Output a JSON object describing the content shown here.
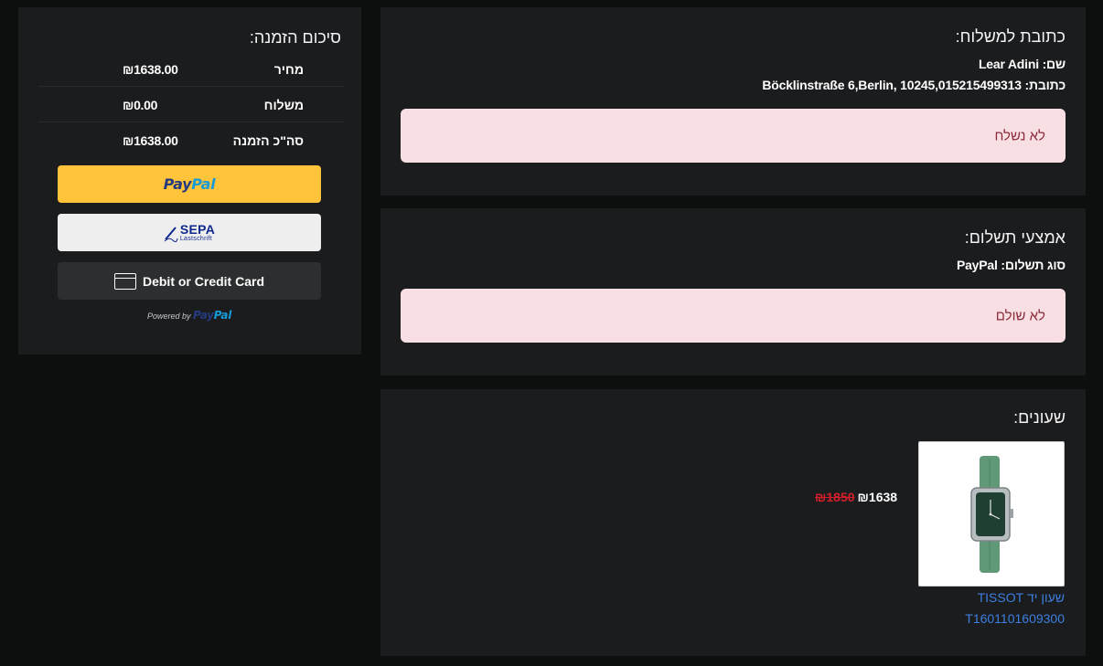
{
  "shipping": {
    "title": "כתובת למשלוח:",
    "name_line": "שם: Lear Adini",
    "address_line": "כתובת: Böcklinstraße 6,Berlin, 10245,015215499313",
    "status": "לא נשלח"
  },
  "payment": {
    "title": "אמצעי תשלום:",
    "type_line": "סוג תשלום: PayPal",
    "status": "לא שולם"
  },
  "products": {
    "title": "שעונים:",
    "items": [
      {
        "name": "שעון יד TISSOT",
        "sku": "T1601101609300",
        "price_new": "₪1638",
        "price_old": "₪1850"
      }
    ]
  },
  "summary": {
    "title": "סיכום הזמנה:",
    "rows": [
      {
        "label": "מחיר",
        "value": "₪1638.00"
      },
      {
        "label": "משלוח",
        "value": "₪0.00"
      },
      {
        "label": "סה\"כ הזמנה",
        "value": "₪1638.00"
      }
    ],
    "paypal_a": "Pay",
    "paypal_b": "Pal",
    "sepa_main": "SEPA",
    "sepa_sub": "Lastschrift",
    "card_label": "Debit or Credit Card",
    "powered_by": "Powered by",
    "powered_a": "Pay",
    "powered_b": "Pal"
  },
  "colors": {
    "background": "#0d0e0e",
    "card": "#1b1c1e",
    "alert_bg": "#f8dfe3",
    "alert_text": "#8c2a3a",
    "paypal_yellow": "#ffc439",
    "link_blue": "#3d7fe0",
    "old_price_red": "#d21f2b"
  }
}
